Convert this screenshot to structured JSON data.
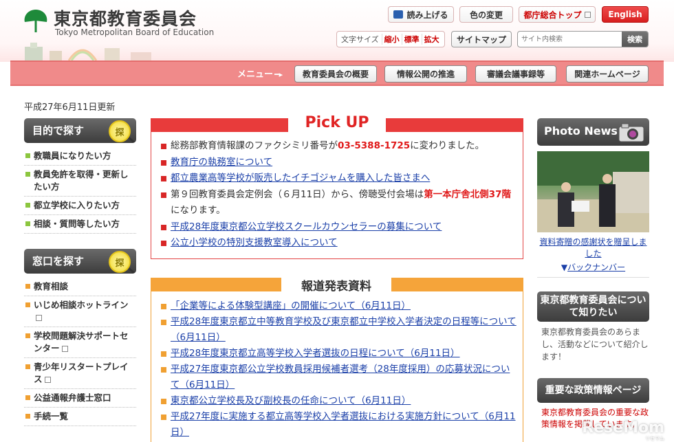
{
  "header": {
    "logo_jp": "東京都教育委員会",
    "logo_en": "Tokyo Metropolitan Board of Education",
    "read_aloud": "読み上げる",
    "color_change": "色の変更",
    "tocho_top": "都庁総合トップ",
    "english": "English",
    "font_size_label": "文字サイズ",
    "font_small": "縮小",
    "font_standard": "標準",
    "font_large": "拡大",
    "sitemap": "サイトマップ",
    "search_placeholder": "サイト内検索",
    "search_button": "検索",
    "brand_color": "#e83b3b"
  },
  "menu": {
    "label": "メニュー",
    "items": [
      "教育委員会の概要",
      "情報公開の推進",
      "審議会議事録等",
      "関連ホームページ"
    ]
  },
  "updated": "平成27年6月11日更新",
  "left": {
    "purpose_title": "目的で探す",
    "purpose_badge": "探",
    "purpose_items": [
      "教職員になりたい方",
      "教員免許を取得・更新したい方",
      "都立学校に入りたい方",
      "相談・質問等したい方"
    ],
    "window_title": "窓口を探す",
    "window_badge": "探",
    "window_items": [
      "教育相談",
      "いじめ相談ホットライン",
      "学校問題解決サポートセンター",
      "青少年リスタートプレイス",
      "公益通報弁護士窓口",
      "手続一覧"
    ]
  },
  "pickup": {
    "title": "Pick UP",
    "item1_text": "総務部教育情報課のファクシミリ番号が",
    "item1_red": "03-5388-1725",
    "item1_tail": "に変わりました。",
    "item2": "教育庁の執務室について",
    "item3": "都立農業高等学校が販売したイチゴジャムを購入した皆さまへ",
    "item4_text": "第９回教育委員会定例会（６月11日）から、傍聴受付会場は",
    "item4_red": "第一本庁舎北側37階",
    "item4_tail": "になります。",
    "item5": "平成28年度東京都公立学校スクールカウンセラーの募集について",
    "item6": "公立小学校の特別支援教室導入について"
  },
  "press": {
    "title": "報道発表資料",
    "items": [
      "「企業等による体験型講座」の開催について（6月11日）",
      "平成28年度東京都立中等教育学校及び東京都立中学校入学者決定の日程等について（6月11日）",
      "平成28年度東京都立高等学校入学者選抜の日程について（6月11日）",
      "平成27年度東京都公立学校教員採用候補者選考（28年度採用）の応募状況について（6月11日）",
      "東京都公立学校長及び副校長の任命について（6月11日）",
      "平成27年度に実施する都立高等学校入学者選抜における実施方針について（6月11日）"
    ]
  },
  "right": {
    "photo_news": "Photo News",
    "photo_caption": "資料寄贈の感謝状を贈呈しました",
    "backnumber": "バックナンバー",
    "about_title": "東京都教育委員会について知りたい",
    "about_desc": "東京都教育委員会のあらまし、活動などについて紹介します！",
    "policy_title": "重要な政策情報ページ",
    "policy_desc": "東京都教育委員会の重要な政策情報を掲載しています。"
  },
  "watermark": {
    "text": "ReseMom",
    "sub": "リセマム"
  }
}
